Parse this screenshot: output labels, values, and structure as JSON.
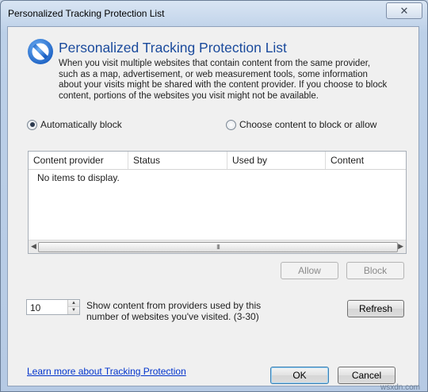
{
  "window": {
    "title": "Personalized Tracking Protection List",
    "close_symbol": "✕"
  },
  "header": {
    "icon": "no-entry-icon",
    "heading": "Personalized Tracking Protection List",
    "description": "When you visit multiple websites that contain content from the same provider, such as a map, advertisement, or web measurement tools, some information about your visits might be shared with the content provider.  If you choose to block content, portions of the websites you visit might not be available."
  },
  "options": {
    "auto_block_label": "Automatically block",
    "auto_block_selected": true,
    "choose_label": "Choose content to block or allow",
    "choose_selected": false
  },
  "list": {
    "columns": [
      "Content provider",
      "Status",
      "Used by",
      "Content"
    ],
    "empty_message": "No items to display.",
    "scroll_grip": "III"
  },
  "actions": {
    "allow_label": "Allow",
    "block_label": "Block"
  },
  "threshold": {
    "value": "10",
    "label": "Show content from providers used by this number of websites you've visited. (3-30)",
    "refresh_label": "Refresh"
  },
  "footer": {
    "learn_more": "Learn more about Tracking Protection",
    "ok_label": "OK",
    "cancel_label": "Cancel",
    "watermark": "wsxdn.com"
  },
  "colors": {
    "heading": "#1a4a9c",
    "link": "#0033cc",
    "icon_blue": "#1f6fd1"
  }
}
